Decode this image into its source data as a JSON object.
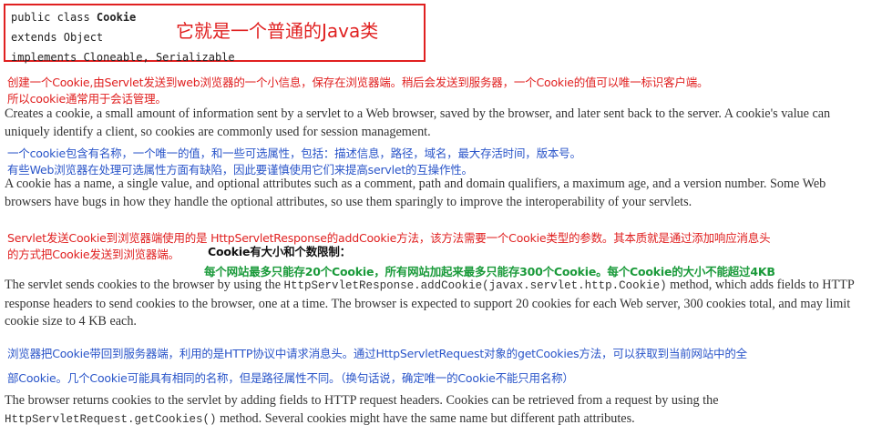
{
  "class_box": {
    "line1_prefix": "public class ",
    "line1_class": "Cookie",
    "line2": "extends Object",
    "line3": "implements Cloneable, Serializable",
    "annotation": "它就是一个普通的Java类"
  },
  "note1": {
    "line1": "创建一个Cookie,由Servlet发送到web浏览器的一个小信息，保存在浏览器端。稍后会发送到服务器，一个Cookie的值可以唯一标识客户端。",
    "line2": "所以cookie通常用于会话管理。"
  },
  "para1": "Creates a cookie, a small amount of information sent by a servlet to a Web browser, saved by the browser, and later sent back to the server. A cookie's value can uniquely identify a client, so cookies are commonly used for session management.",
  "note2": {
    "line1": "一个cookie包含有名称，一个唯一的值，和一些可选属性，包括：描述信息，路径，域名，最大存活时间，版本号。",
    "line2": "有些Web浏览器在处理可选属性方面有缺陷，因此要谨慎使用它们来提高servlet的互操作性。"
  },
  "para2": "A cookie has a name, a single value, and optional attributes such as a comment, path and domain qualifiers, a maximum age, and a version number. Some Web browsers have bugs in how they handle the optional attributes, so use them sparingly to improve the interoperability of your servlets.",
  "note3": {
    "line1": "Servlet发送Cookie到浏览器端使用的是 HttpServletResponse的addCookie方法，该方法需要一个Cookie类型的参数。其本质就是通过添加响应消息头",
    "line2": "的方式把Cookie发送到浏览器端。"
  },
  "limits": {
    "title": "Cookie有大小和个数限制：",
    "detail": "每个网站最多只能存20个Cookie，所有网站加起来最多只能存300个Cookie。每个Cookie的大小不能超过4KB"
  },
  "para3": {
    "before": "The servlet sends cookies to the browser by using the ",
    "code": "HttpServletResponse.addCookie(javax.servlet.http.Cookie)",
    "after": " method, which adds fields to HTTP response headers to send cookies to the browser, one at a time. The browser is expected to support 20 cookies for each Web server, 300 cookies total, and may limit cookie size to 4 KB each."
  },
  "note4": {
    "line1": "浏览器把Cookie带回到服务器端，利用的是HTTP协议中请求消息头。通过HttpServletRequest对象的getCookies方法，可以获取到当前网站中的全",
    "line2": "部Cookie。几个Cookie可能具有相同的名称，但是路径属性不同。（换句话说，确定唯一的Cookie不能只用名称）"
  },
  "para4": {
    "before": "The browser returns cookies to the servlet by adding fields to HTTP request headers. Cookies can be retrieved from a request by using the ",
    "code": "HttpServletRequest.getCookies()",
    "after": " method. Several cookies might have the same name but different path attributes."
  },
  "colors": {
    "red": "#e02020",
    "blue": "#2a55c9",
    "green": "#1a9a3a"
  }
}
